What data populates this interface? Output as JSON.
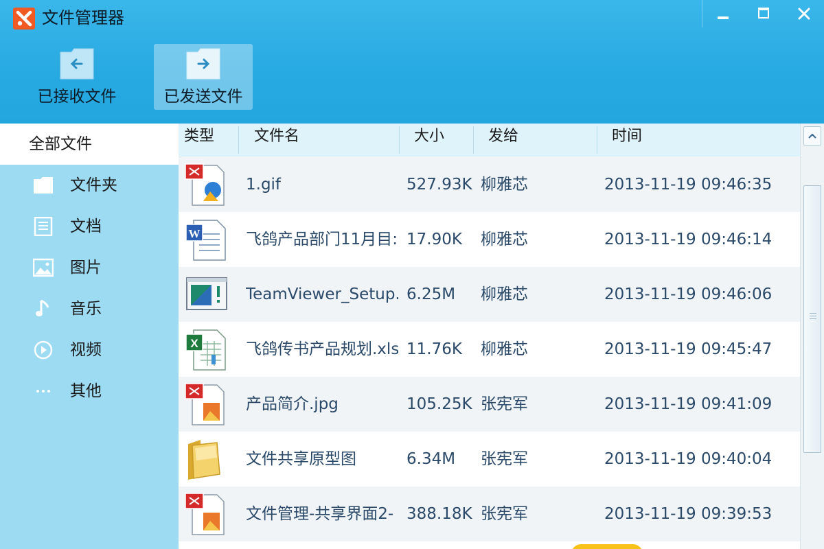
{
  "window": {
    "title": "文件管理器"
  },
  "toolbar": {
    "received_label": "已接收文件",
    "sent_label": "已发送文件",
    "active": "sent"
  },
  "sidebar": {
    "all_files": "全部文件",
    "items": [
      {
        "icon": "folder-icon",
        "label": "文件夹"
      },
      {
        "icon": "document-icon",
        "label": "文档"
      },
      {
        "icon": "image-icon",
        "label": "图片"
      },
      {
        "icon": "music-icon",
        "label": "音乐"
      },
      {
        "icon": "video-icon",
        "label": "视频"
      },
      {
        "icon": "more-icon",
        "label": "其他"
      }
    ]
  },
  "table": {
    "columns": [
      "类型",
      "文件名",
      "大小",
      "发给",
      "时间"
    ],
    "rows": [
      {
        "type_icon": "image-file-icon",
        "name": "1.gif",
        "size": "527.93K",
        "to": "柳雅芯",
        "time": "2013-11-19 09:46:35"
      },
      {
        "type_icon": "word-file-icon",
        "name": "飞鸽产品部门11月目:",
        "size": "17.90K",
        "to": "柳雅芯",
        "time": "2013-11-19 09:46:14"
      },
      {
        "type_icon": "executable-file-icon",
        "name": "TeamViewer_Setup.",
        "size": "6.25M",
        "to": "柳雅芯",
        "time": "2013-11-19 09:46:06"
      },
      {
        "type_icon": "excel-file-icon",
        "name": "飞鸽传书产品规划.xls",
        "size": "11.76K",
        "to": "柳雅芯",
        "time": "2013-11-19 09:45:47"
      },
      {
        "type_icon": "image-file-icon",
        "name": "产品简介.jpg",
        "size": "105.25K",
        "to": "张宪军",
        "time": "2013-11-19 09:41:09"
      },
      {
        "type_icon": "folder-file-icon",
        "name": "文件共享原型图",
        "size": "6.34M",
        "to": "张宪军",
        "time": "2013-11-19 09:40:04"
      },
      {
        "type_icon": "image-file-icon",
        "name": "文件管理-共享界面2-",
        "size": "388.18K",
        "to": "张宪军",
        "time": "2013-11-19 09:39:53"
      }
    ]
  },
  "colors": {
    "header_blue": "#27a9e1",
    "sidebar_blue": "#9ddbf3",
    "text_blue": "#2b4a6a",
    "logo_orange": "#f15a22"
  }
}
